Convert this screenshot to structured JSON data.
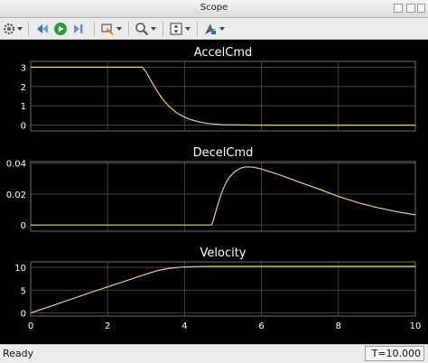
{
  "window": {
    "title": "Scope"
  },
  "toolbar": {
    "icons": [
      "gear-icon",
      "dropdown-arrow-icon",
      "step-back-icon",
      "run-icon",
      "step-forward-icon",
      "highlight-icon",
      "dropdown-arrow-icon",
      "zoom-icon",
      "dropdown-arrow-icon",
      "autoscale-icon",
      "dropdown-arrow-icon",
      "cursor-measure-icon",
      "dropdown-arrow-icon"
    ]
  },
  "status": {
    "text": "Ready",
    "time": "T=10.000"
  },
  "colors": {
    "background": "#000000",
    "axes": "#000000",
    "grid": "#4d4d4d",
    "trace": "#e6d27a",
    "text": "#ffffff"
  },
  "chart_data": [
    {
      "type": "line",
      "title": "AccelCmd",
      "xlim": [
        0,
        10
      ],
      "ylim": [
        -0.3,
        3.3
      ],
      "yticks": [
        "0",
        "1",
        "2",
        "3"
      ],
      "xticks": [],
      "grid": true,
      "x": [
        0,
        2.9,
        3.0,
        3.1,
        3.2,
        3.3,
        3.4,
        3.5,
        3.6,
        3.8,
        4.0,
        4.2,
        4.4,
        4.6,
        5.0,
        6.0,
        10.0
      ],
      "y": [
        3,
        3,
        2.75,
        2.4,
        2.05,
        1.72,
        1.43,
        1.18,
        0.96,
        0.63,
        0.41,
        0.26,
        0.16,
        0.09,
        0.02,
        0.0,
        0.0
      ]
    },
    {
      "type": "line",
      "title": "DecelCmd",
      "xlim": [
        0,
        10
      ],
      "ylim": [
        -0.004,
        0.041
      ],
      "yticks": [
        "0",
        "0.02",
        "0.04"
      ],
      "xticks": [],
      "grid": true,
      "x": [
        0,
        4.7,
        4.75,
        4.85,
        4.95,
        5.05,
        5.15,
        5.3,
        5.45,
        5.6,
        5.8,
        6.0,
        6.5,
        7.0,
        7.5,
        8.0,
        8.5,
        9.0,
        9.5,
        10.0
      ],
      "y": [
        0,
        0,
        0.003,
        0.012,
        0.02,
        0.026,
        0.0305,
        0.0345,
        0.0368,
        0.0376,
        0.0374,
        0.0362,
        0.0322,
        0.0276,
        0.0232,
        0.0185,
        0.0145,
        0.0113,
        0.0087,
        0.0066
      ]
    },
    {
      "type": "line",
      "title": "Velocity",
      "xlim": [
        0,
        10
      ],
      "ylim": [
        -0.7,
        11.2
      ],
      "yticks": [
        "0",
        "5",
        "10"
      ],
      "xticks": [
        "0",
        "2",
        "4",
        "6",
        "8",
        "10"
      ],
      "grid": true,
      "x": [
        0,
        0.5,
        1.0,
        1.5,
        2.0,
        2.5,
        3.0,
        3.3,
        3.6,
        3.9,
        4.2,
        4.6,
        5.0,
        10.0
      ],
      "y": [
        0,
        1.4,
        2.85,
        4.3,
        5.7,
        7.1,
        8.5,
        9.3,
        9.8,
        10.05,
        10.15,
        10.2,
        10.2,
        10.2
      ]
    }
  ]
}
